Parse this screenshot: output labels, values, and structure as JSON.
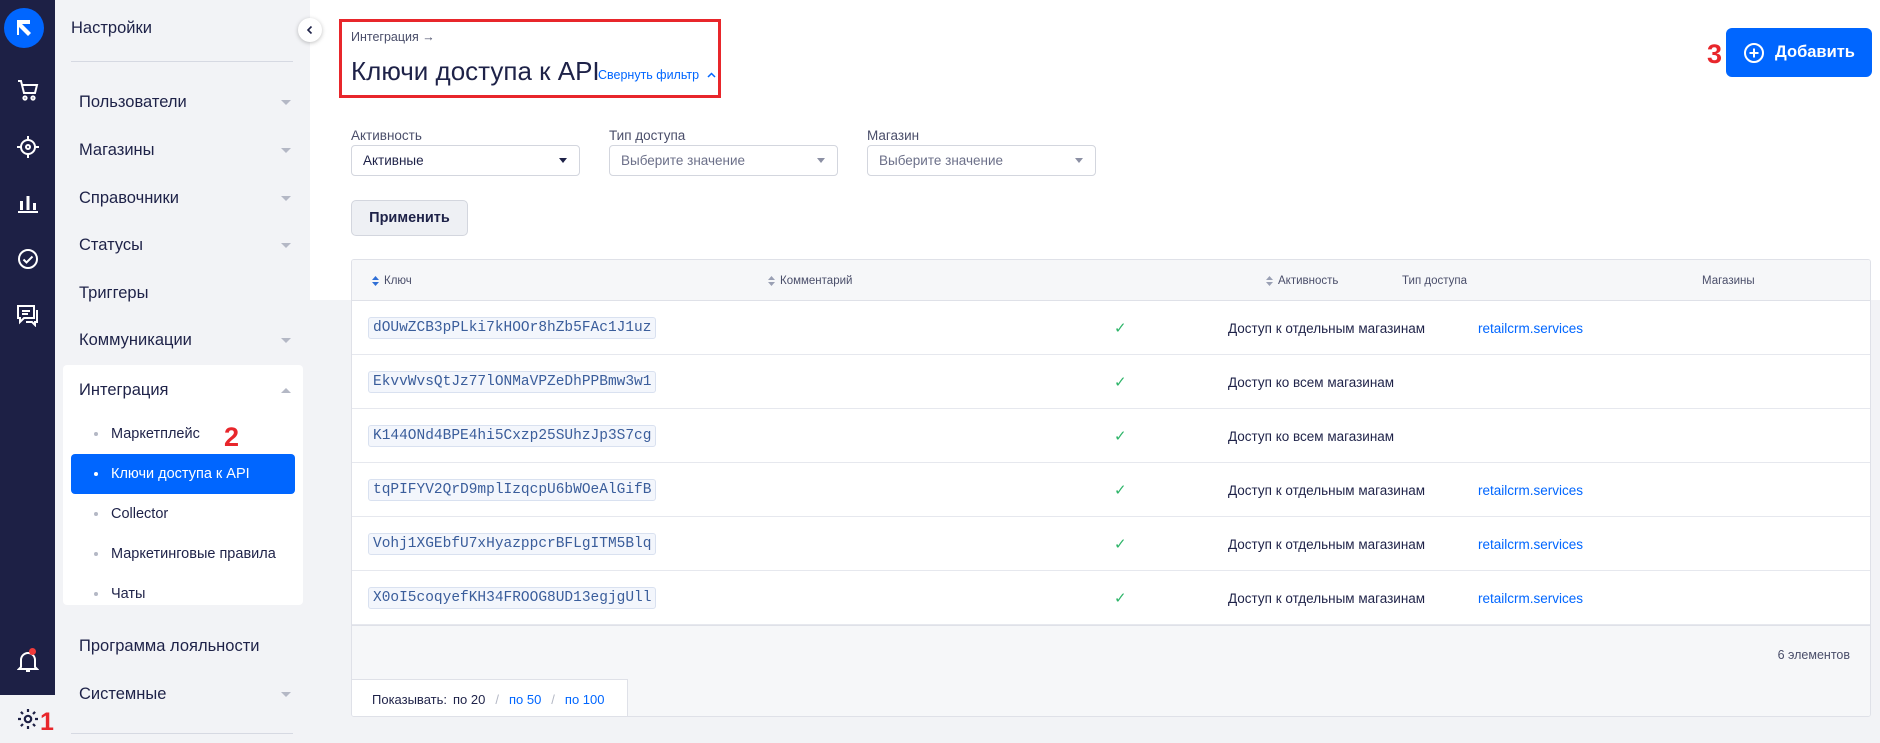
{
  "sidebar": {
    "title": "Настройки",
    "items": [
      {
        "label": "Пользователи"
      },
      {
        "label": "Магазины"
      },
      {
        "label": "Справочники"
      },
      {
        "label": "Статусы"
      },
      {
        "label": "Триггеры"
      },
      {
        "label": "Коммуникации"
      },
      {
        "label": "Интеграция"
      },
      {
        "label": "Программа лояльности"
      },
      {
        "label": "Системные"
      }
    ],
    "sub_items": [
      {
        "label": "Маркетплейс"
      },
      {
        "label": "Ключи доступа к API"
      },
      {
        "label": "Collector"
      },
      {
        "label": "Маркетинговые правила"
      },
      {
        "label": "Чаты"
      }
    ],
    "active_sub_index": 1
  },
  "header": {
    "breadcrumb": "Интеграция →",
    "title": "Ключи доступа к API",
    "filter_toggle": "Свернуть фильтр",
    "add_button": "Добавить"
  },
  "filters": {
    "activity": {
      "label": "Активность",
      "value": "Активные"
    },
    "access_type": {
      "label": "Тип доступа",
      "placeholder": "Выберите значение"
    },
    "shop": {
      "label": "Магазин",
      "placeholder": "Выберите значение"
    },
    "apply_button": "Применить"
  },
  "table": {
    "columns": {
      "key": "Ключ",
      "comment": "Комментарий",
      "active": "Активность",
      "access": "Тип доступа",
      "shops": "Магазины"
    },
    "rows": [
      {
        "key": "dOUwZCB3pPLki7kHOOr8hZb5FAc1J1uz",
        "comment": "",
        "active": "✓",
        "access": "Доступ к отдельным магазинам",
        "shop": "retailcrm.services"
      },
      {
        "key": "EkvvWvsQtJz77lONMaVPZeDhPPBmw3w1",
        "comment": "",
        "active": "✓",
        "access": "Доступ ко всем магазинам",
        "shop": ""
      },
      {
        "key": "K144ONd4BPE4hi5Cxzp25SUhzJp3S7cg",
        "comment": "",
        "active": "✓",
        "access": "Доступ ко всем магазинам",
        "shop": ""
      },
      {
        "key": "tqPIFYV2QrD9mplIzqcpU6bWOeAlGifB",
        "comment": "",
        "active": "✓",
        "access": "Доступ к отдельным магазинам",
        "shop": "retailcrm.services"
      },
      {
        "key": "Vohj1XGEbfU7xHyazppcrBFLgITM5Blq",
        "comment": "",
        "active": "✓",
        "access": "Доступ к отдельным магазинам",
        "shop": "retailcrm.services"
      },
      {
        "key": "X0oI5coqyefKH34FROOG8UD13egjgUll",
        "comment": "",
        "active": "✓",
        "access": "Доступ к отдельным магазинам",
        "shop": "retailcrm.services"
      }
    ],
    "count_text": "6 элементов",
    "pager": {
      "label": "Показывать:",
      "current": "по 20",
      "opt50": "по 50",
      "opt100": "по 100",
      "sep": "/"
    }
  },
  "annotations": {
    "one": "1",
    "two": "2",
    "three": "3"
  },
  "colors": {
    "accent": "#0066ff",
    "rail": "#1d2045",
    "annotation": "#e8262b",
    "check": "#2fb56a"
  }
}
